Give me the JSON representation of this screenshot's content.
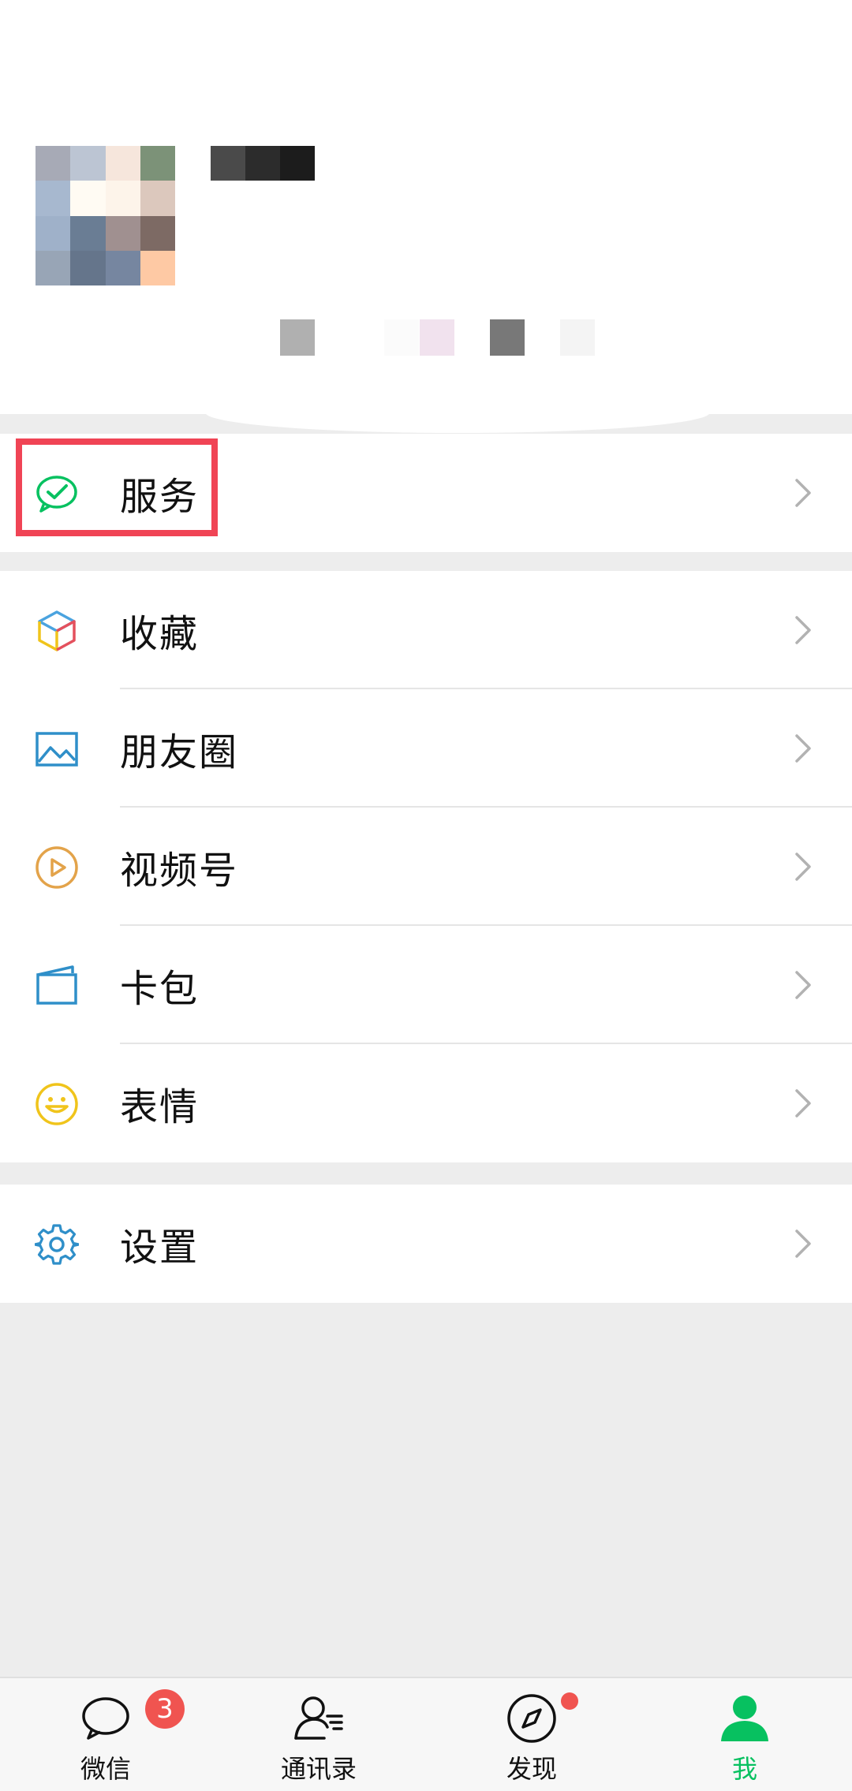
{
  "profile": {
    "avatar_label": "avatar (pixelated)",
    "nickname_label": "nickname (pixelated)",
    "wechat_id_label": "wechat id (pixelated)"
  },
  "menu": {
    "services": {
      "label": "服务",
      "icon": "services-check-bubble-icon"
    },
    "favorites": {
      "label": "收藏",
      "icon": "cube-icon"
    },
    "moments": {
      "label": "朋友圈",
      "icon": "picture-icon"
    },
    "channels": {
      "label": "视频号",
      "icon": "play-circle-icon"
    },
    "cards": {
      "label": "卡包",
      "icon": "wallet-card-icon"
    },
    "stickers": {
      "label": "表情",
      "icon": "smiley-icon"
    },
    "settings": {
      "label": "设置",
      "icon": "gear-icon"
    }
  },
  "tabbar": {
    "chats": {
      "label": "微信",
      "badge": "3",
      "icon": "chat-bubble-icon"
    },
    "contacts": {
      "label": "通讯录",
      "icon": "contacts-icon"
    },
    "discover": {
      "label": "发现",
      "icon": "compass-icon",
      "dot": true
    },
    "me": {
      "label": "我",
      "icon": "person-icon",
      "active": true
    }
  },
  "colors": {
    "accent": "#07c160",
    "badge": "#f05450",
    "highlight": "#f04455",
    "background": "#ededed"
  }
}
